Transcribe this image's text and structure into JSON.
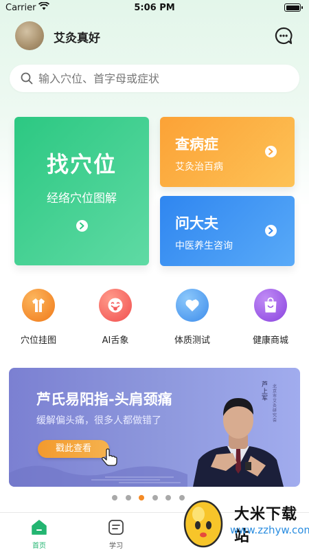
{
  "status_bar": {
    "carrier": "Carrier",
    "time": "5:06 PM"
  },
  "header": {
    "username": "艾灸真好"
  },
  "search": {
    "placeholder": "输入穴位、首字母或症状"
  },
  "cards": {
    "find": {
      "title": "找穴位",
      "subtitle": "经络穴位图解"
    },
    "disease": {
      "title": "查病症",
      "subtitle": "艾灸治百病"
    },
    "doctor": {
      "title": "问大夫",
      "subtitle": "中医养生咨询"
    }
  },
  "quick_links": [
    {
      "label": "穴位挂图",
      "icon": "robe-icon",
      "color": "#f58c28"
    },
    {
      "label": "AI舌象",
      "icon": "tongue-face-icon",
      "color": "#f45b5b"
    },
    {
      "label": "体质测试",
      "icon": "heart-icon",
      "color": "#4a9bef"
    },
    {
      "label": "健康商城",
      "icon": "shopping-bag-icon",
      "color": "#9b55e6"
    }
  ],
  "banner": {
    "title": "芦氏易阳指-头肩颈痛",
    "subtitle": "缓解偏头痛，很多人都做错了",
    "button": "戳此查看",
    "vertical_text": "芦上军",
    "vertical_small": "北京市艾灸研究会"
  },
  "carousel": {
    "count": 6,
    "active_index": 2
  },
  "tabbar": {
    "items": [
      {
        "label": "首页"
      },
      {
        "label": "学习"
      }
    ]
  },
  "watermark": {
    "title": "大米下载站",
    "url": "www.zzhyw.com"
  },
  "colors": {
    "primary": "#23b571",
    "find": "#2cc882",
    "disease": "#fca236",
    "doctor": "#2f86f0",
    "dot_active": "#f48a25"
  }
}
